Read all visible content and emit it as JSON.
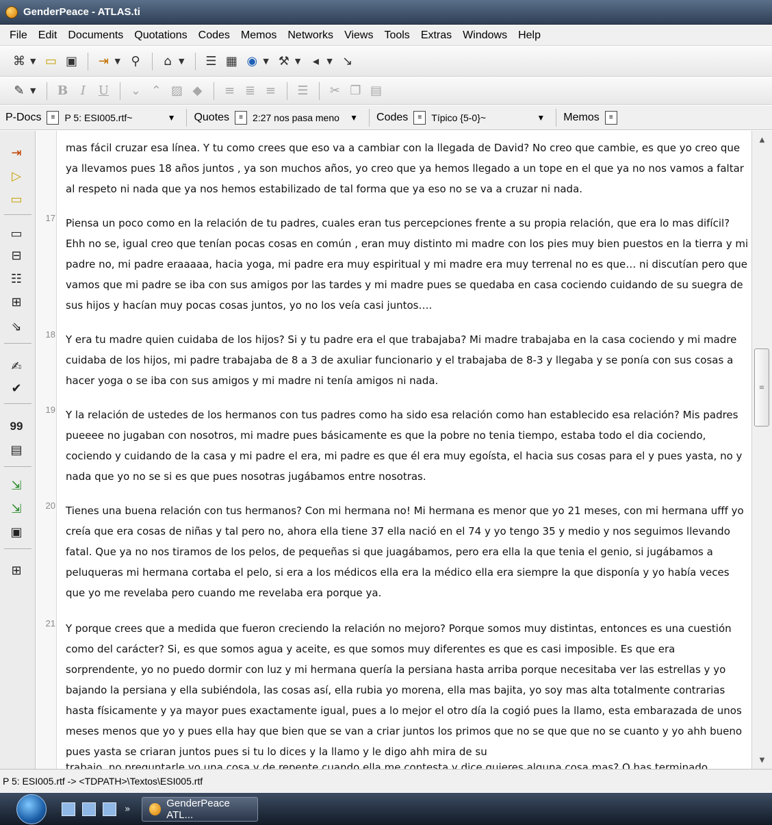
{
  "window": {
    "title": "GenderPeace - ATLAS.ti"
  },
  "menu": [
    "File",
    "Edit",
    "Documents",
    "Quotations",
    "Codes",
    "Memos",
    "Networks",
    "Views",
    "Tools",
    "Extras",
    "Windows",
    "Help"
  ],
  "nav": {
    "pdocs_label": "P-Docs",
    "pdocs_value": "P 5: ESI005.rtf~",
    "quotes_label": "Quotes",
    "quotes_value": "2:27 nos pasa meno",
    "codes_label": "Codes",
    "codes_value": "Típico {5-0}~",
    "memos_label": "Memos"
  },
  "sidebar": {
    "quote_count_icon": "99"
  },
  "paragraphs": [
    {
      "num": "",
      "text": "mas fácil cruzar esa línea. Y tu como crees que eso va a cambiar con la llegada de David? No creo que cambie, es que yo creo que ya llevamos pues 18 años juntos , ya son muchos años, yo creo que ya hemos llegado a un tope en el que ya no nos vamos a faltar al respeto ni nada que ya nos hemos estabilizado de tal forma que ya eso no se va a cruzar ni nada."
    },
    {
      "num": "17",
      "text": "Piensa un poco como en la relación de tu padres, cuales eran tus percepciones frente a su propia relación, que era lo mas difícil? Ehh no se, igual creo que tenían pocas cosas en común , eran muy distinto  mi madre con los pies muy bien puestos en la tierra y mi padre no, mi padre eraaaaa, hacia yoga, mi padre era muy espiritual y mi madre era muy terrenal no es que… ni discutían pero que vamos que mi padre se iba con sus amigos por las tardes y mi madre pues se quedaba en casa cociendo cuidando de su suegra de sus hijos y hacían muy pocas cosas juntos, yo no los veía casi juntos…."
    },
    {
      "num": "18",
      "text": "Y era tu madre quien cuidaba de los hijos? Si y tu padre era el que trabajaba? Mi madre trabajaba en la casa cociendo y mi madre cuidaba de los hijos, mi padre trabajaba de 8 a 3 de axuliar funcionario y el trabajaba de 8-3 y llegaba y se ponía con sus cosas a hacer yoga o se iba con sus amigos y mi madre ni tenía amigos ni nada."
    },
    {
      "num": "19",
      "text": "Y la relación de ustedes de los hermanos con tus padres como ha sido esa relación como han establecido esa relación? Mis padres pueeee no jugaban con nosotros, mi madre pues básicamente es que la pobre no tenia tiempo, estaba todo el dia cociendo, cociendo y cuidando de la casa y mi padre el era, mi padre es que él era muy egoísta, el hacia sus cosas para el y pues yasta, no y nada que yo no se si es que pues nosotras jugábamos entre nosotras."
    },
    {
      "num": "20",
      "text": "Tienes una buena relación con tus hermanos? Con mi hermana no! Mi hermana es menor que yo 21 meses, con mi hermana ufff yo creía que era cosas de niñas y tal pero no, ahora ella tiene 37 ella nació en el 74 y yo tengo 35 y medio y nos seguimos llevando fatal. Que ya no nos tiramos de los pelos, de pequeñas si que juagábamos, pero era ella la que tenia el genio, si jugábamos a peluqueras mi hermana cortaba el pelo, si era a los médicos ella era la médico ella era siempre la que disponía y yo había veces que yo me revelaba pero cuando me revelaba era porque ya."
    },
    {
      "num": "21",
      "text": "Y porque crees que a medida que fueron creciendo la relación no mejoro? Porque somos muy distintas, entonces es una cuestión como del carácter? Si, es que somos agua y aceite, es que somos muy diferentes es que es casi imposible. Es que era sorprendente, yo no puedo dormir con luz y mi hermana quería la persiana hasta arriba porque necesitaba ver las estrellas y yo bajando la persiana y ella subiéndola, las cosas así, ella rubia yo morena, ella mas bajita, yo soy mas alta totalmente contrarias hasta físicamente y ya mayor pues exactamente igual, pues a lo mejor el otro día la cogió pues la llamo, esta embarazada de unos meses menos que yo y pues ella hay que bien que se van a criar juntos los primos que no se que que no se cuanto y yo ahh bueno pues yasta se criaran juntos pues si tu lo dices y la llamo y le digo ahh mira de su"
    }
  ],
  "clipped_line": "trabajo, no preguntarle yo una cosa y de repente cuando ella me contesta y dice quieres alguna cosa mas? O has terminado",
  "status": {
    "path": "P 5: ESI005.rtf -> <TDPATH>\\Textos\\ESI005.rtf"
  },
  "taskbar": {
    "button_label": "GenderPeace  ATL..."
  },
  "colors": {
    "titlebar": "#2f3f55",
    "taskbar": "#1b2433",
    "accent": "#d97b00"
  }
}
